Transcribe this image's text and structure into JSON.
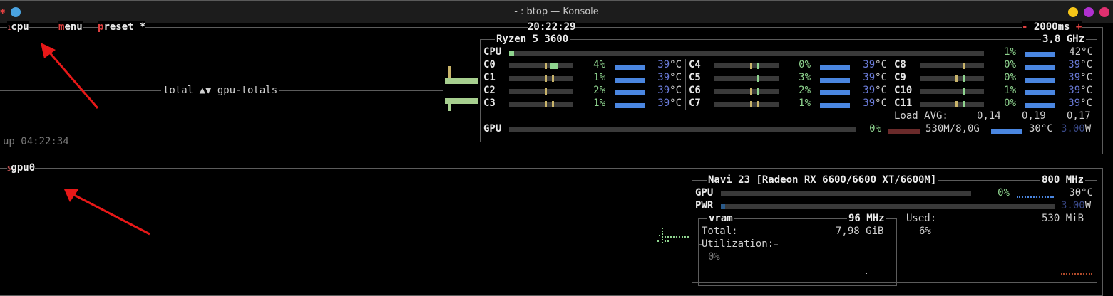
{
  "window": {
    "title": "- : btop — Konsole"
  },
  "cpu_box": {
    "num": "1",
    "name": "cpu",
    "menu_first": "m",
    "menu_rest": "enu",
    "preset_first": "p",
    "preset_rest": "reset *",
    "clock": "20:22:29",
    "minus": "-",
    "interval": "2000ms",
    "plus": "+",
    "graph_label": "total ▲▼ gpu-totals",
    "uptime": "up 04:22:34"
  },
  "cpu_info": {
    "model": "Ryzen 5 3600",
    "freq": "3,8 GHz",
    "total": {
      "label": "CPU",
      "percent": "1%",
      "temp": "42°C",
      "usage": 1
    },
    "cores": [
      {
        "label": "C0",
        "percent": "4%",
        "temp": "39",
        "unit": "°C"
      },
      {
        "label": "C1",
        "percent": "1%",
        "temp": "39",
        "unit": "°C"
      },
      {
        "label": "C2",
        "percent": "2%",
        "temp": "39",
        "unit": "°C"
      },
      {
        "label": "C3",
        "percent": "1%",
        "temp": "39",
        "unit": "°C"
      },
      {
        "label": "C4",
        "percent": "0%",
        "temp": "39",
        "unit": "°C"
      },
      {
        "label": "C5",
        "percent": "3%",
        "temp": "39",
        "unit": "°C"
      },
      {
        "label": "C6",
        "percent": "2%",
        "temp": "39",
        "unit": "°C"
      },
      {
        "label": "C7",
        "percent": "1%",
        "temp": "39",
        "unit": "°C"
      },
      {
        "label": "C8",
        "percent": "0%",
        "temp": "39",
        "unit": "°C"
      },
      {
        "label": "C9",
        "percent": "0%",
        "temp": "39",
        "unit": "°C"
      },
      {
        "label": "C10",
        "percent": "1%",
        "temp": "39",
        "unit": "°C"
      },
      {
        "label": "C11",
        "percent": "0%",
        "temp": "39",
        "unit": "°C"
      }
    ],
    "load": {
      "label": "Load AVG:",
      "v1": "0,14",
      "v5": "0,19",
      "v15": "0,17"
    },
    "gpu": {
      "label": "GPU",
      "percent": "0%",
      "mem": "530M/8,0G",
      "temp": "30°C",
      "power_num": "3.00",
      "power_unit": "W"
    }
  },
  "gpu_box": {
    "num": "5",
    "name": "gpu0",
    "model": "Navi 23 [Radeon RX 6600/6600 XT/6600M]",
    "freq": "800 MHz",
    "gpu_label": "GPU",
    "gpu_percent": "0%",
    "gpu_temp": "30°C",
    "pwr_label": "PWR",
    "pwr_num": "3.00",
    "pwr_unit": "W",
    "vram_title": "vram",
    "vram_freq": "96 MHz",
    "total_label": "Total:",
    "total_value": "7,98 GiB",
    "util_label": "Utilization:",
    "util_value": "0%",
    "used_label": "Used:",
    "used_value": "530 MiB",
    "used_percent": "6%"
  },
  "colors": {
    "accent_red": "#e04040",
    "meter_green": "#8fd48f",
    "temp_blue": "#6a7bd8",
    "bar_blue": "#4a86e0"
  }
}
